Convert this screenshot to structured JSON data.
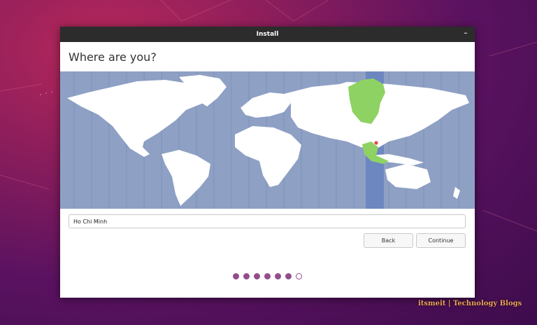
{
  "window": {
    "title": "Install",
    "minimize_glyph": "–"
  },
  "page": {
    "heading": "Where are you?"
  },
  "map": {
    "ocean_color": "#8ea0c4",
    "land_color": "#ffffff",
    "highlight_color": "#8fd264",
    "selected_band_color": "#6d87c0",
    "pin_color": "#e04a4a"
  },
  "location": {
    "value": "Ho Chi Minh"
  },
  "buttons": {
    "back_label": "Back",
    "continue_label": "Continue"
  },
  "progress": {
    "total_steps": 7,
    "completed_steps": 6,
    "accent": "#924e8c"
  },
  "watermark": "itsmeit | Technology Blogs"
}
